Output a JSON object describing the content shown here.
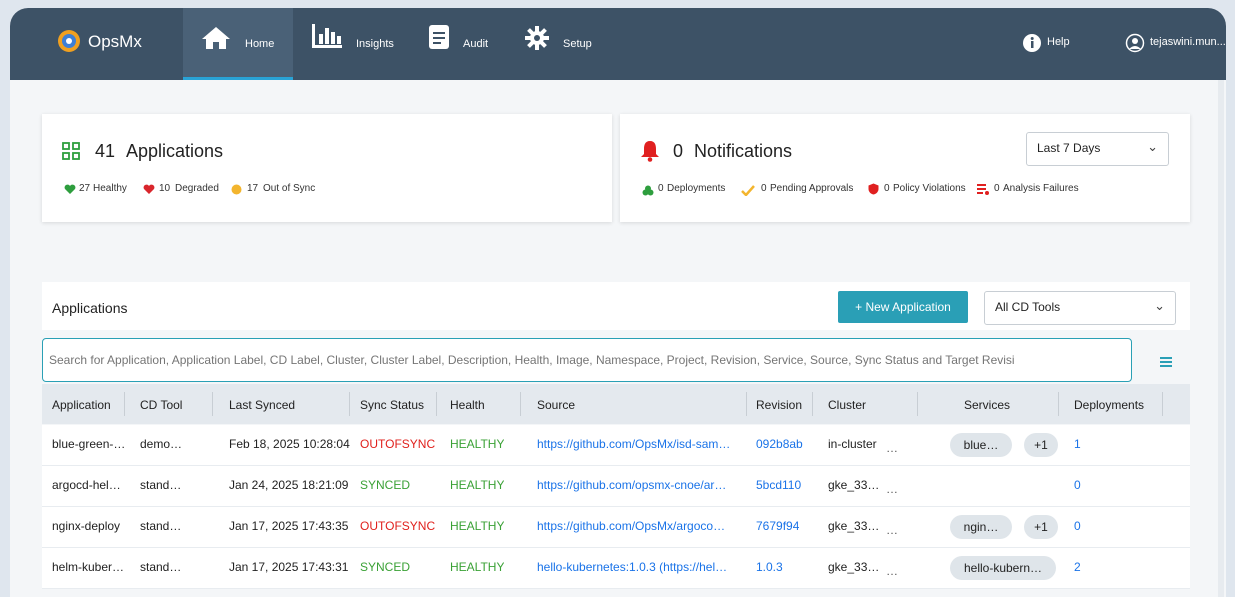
{
  "brand": {
    "name": "OpsMx"
  },
  "nav": {
    "tabs": [
      {
        "label": "Home",
        "icon": "home-icon"
      },
      {
        "label": "Insights",
        "icon": "bar-chart-icon"
      },
      {
        "label": "Audit",
        "icon": "document-icon"
      },
      {
        "label": "Setup",
        "icon": "gear-icon"
      }
    ],
    "help": "Help",
    "user": "tejaswini.mun..."
  },
  "applications_card": {
    "count": "41",
    "title": "Applications",
    "stats": [
      {
        "count": "27",
        "label": "Healthy"
      },
      {
        "count": "10",
        "label": "Degraded"
      },
      {
        "count": "17",
        "label": "Out of Sync"
      }
    ]
  },
  "notifications_card": {
    "count": "0",
    "title": "Notifications",
    "range": "Last 7 Days",
    "stats": [
      {
        "count": "0",
        "label": "Deployments"
      },
      {
        "count": "0",
        "label": "Pending Approvals"
      },
      {
        "count": "0",
        "label": "Policy Violations"
      },
      {
        "count": "0",
        "label": "Analysis Failures"
      }
    ]
  },
  "apps_section": {
    "title": "Applications",
    "new_button": "+ New Application",
    "cd_filter": "All CD Tools",
    "search_placeholder": "Search for Application, Application Label, CD Label, Cluster, Cluster Label, Description, Health, Image, Namespace, Project, Revision, Service, Source, Sync Status and Target Revisi"
  },
  "table": {
    "columns": [
      "Application",
      "CD Tool",
      "Last Synced",
      "Sync Status",
      "Health",
      "Source",
      "Revision",
      "Cluster",
      "Services",
      "Deployments"
    ],
    "rows": [
      {
        "application": "blue-green-…",
        "cd_tool": "demo…",
        "last_synced": "Feb 18, 2025 10:28:04",
        "sync_status": "OUTOFSYNC",
        "health": "HEALTHY",
        "source": "https://github.com/OpsMx/isd-sam…",
        "revision": "092b8ab",
        "cluster": "in-cluster",
        "cluster_more": "…",
        "service": "blue…",
        "service_more": "+1",
        "deployments": "1"
      },
      {
        "application": "argocd-hel…",
        "cd_tool": "stand…",
        "last_synced": "Jan 24, 2025 18:21:09",
        "sync_status": "SYNCED",
        "health": "HEALTHY",
        "source": "https://github.com/opsmx-cnoe/ar…",
        "revision": "5bcd110",
        "cluster": "gke_33…",
        "cluster_more": "…",
        "service": "",
        "service_more": "",
        "deployments": "0"
      },
      {
        "application": "nginx-deploy",
        "cd_tool": "stand…",
        "last_synced": "Jan 17, 2025 17:43:35",
        "sync_status": "OUTOFSYNC",
        "health": "HEALTHY",
        "source": "https://github.com/OpsMx/argoco…",
        "revision": "7679f94",
        "cluster": "gke_33…",
        "cluster_more": "…",
        "service": "ngin…",
        "service_more": "+1",
        "deployments": "0"
      },
      {
        "application": "helm-kuber…",
        "cd_tool": "stand…",
        "last_synced": "Jan 17, 2025 17:43:31",
        "sync_status": "SYNCED",
        "health": "HEALTHY",
        "source": "hello-kubernetes:1.0.3 (https://hel…",
        "revision": "1.0.3",
        "cluster": "gke_33…",
        "cluster_more": "…",
        "service": "hello-kubern…",
        "service_more": "",
        "deployments": "2"
      }
    ]
  },
  "colors": {
    "nav_bg": "#3d5266",
    "accent": "#2aa0b5",
    "outofsync": "#e0201c",
    "synced": "#3aa135",
    "healthy": "#3aa135",
    "link": "#1a73e8"
  }
}
